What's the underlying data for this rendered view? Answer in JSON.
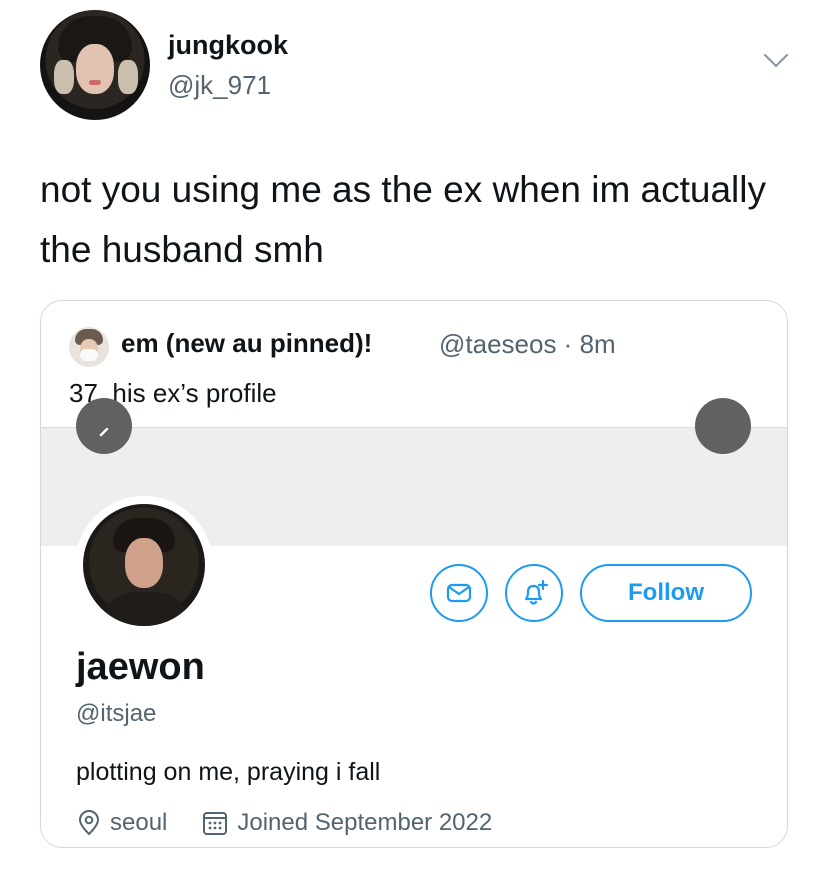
{
  "tweet": {
    "display_name": "jungkook",
    "handle": "@jk_971",
    "text": "not you using me as the ex when im actually the husband smh"
  },
  "quote": {
    "display_name": "em (new au pinned)!",
    "handle_time": "@taeseos · 8m",
    "text": "37. his ex’s profile"
  },
  "profile": {
    "name": "jaewon",
    "handle": "@itsjae",
    "bio": "plotting on me, praying i fall",
    "location": "seoul",
    "joined": "Joined September 2022",
    "follow_label": "Follow"
  },
  "colors": {
    "accent": "#1d9bf0",
    "secondary_text": "#536471",
    "banner": "#eeeeee"
  }
}
